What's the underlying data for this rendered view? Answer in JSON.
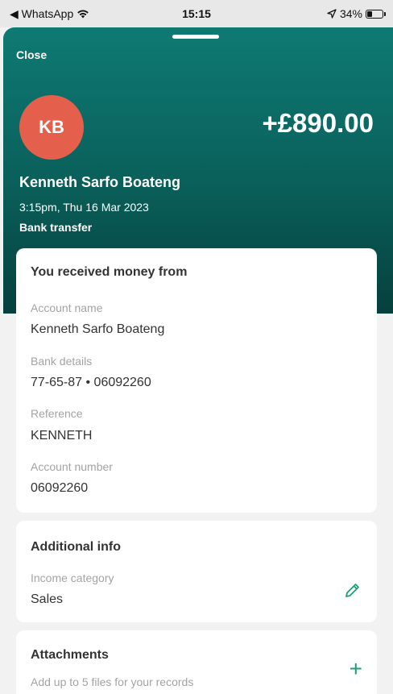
{
  "status_bar": {
    "back_app": "◀ WhatsApp",
    "time": "15:15",
    "battery_percent": "34%",
    "battery_level": 0.34,
    "icons": [
      "wifi-icon",
      "location-arrow-icon",
      "battery-icon"
    ]
  },
  "header": {
    "close_label": "Close",
    "avatar_initials": "KB",
    "amount": "+£890.00",
    "name": "Kenneth Sarfo Boateng",
    "datetime": "3:15pm, Thu 16 Mar 2023",
    "method": "Bank transfer"
  },
  "received_card": {
    "title": "You received money from",
    "fields": [
      {
        "label": "Account name",
        "value": "Kenneth Sarfo Boateng"
      },
      {
        "label": "Bank details",
        "value": "77-65-87 • 06092260"
      },
      {
        "label": "Reference",
        "value": "KENNETH"
      },
      {
        "label": "Account number",
        "value": "06092260"
      }
    ]
  },
  "additional_card": {
    "title": "Additional info",
    "label": "Income category",
    "value": "Sales",
    "edit_icon": "pencil-icon"
  },
  "attachments_card": {
    "title": "Attachments",
    "subtitle": "Add up to 5 files for your records",
    "add_icon": "plus-icon"
  },
  "colors": {
    "hero_top": "#0e7a73",
    "hero_bottom": "#06403d",
    "avatar_bg": "#e4604c",
    "accent_green": "#1aa07a",
    "page_bg": "#f2f2f2"
  }
}
